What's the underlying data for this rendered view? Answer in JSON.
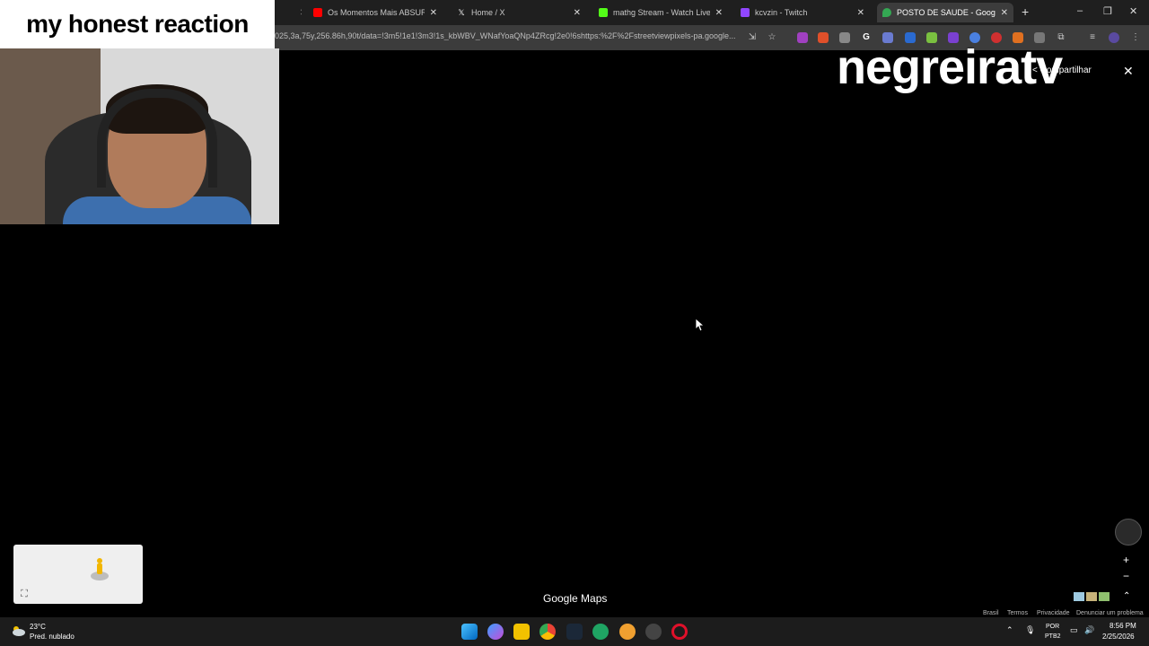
{
  "overlay": {
    "title": "my honest reaction",
    "watermark": "negreiratv"
  },
  "browser": {
    "tabs": [
      {
        "title": "Os Momentos Mais ABSURDOS",
        "color": "#ff0000"
      },
      {
        "title": "Home / X",
        "color": "#ffffff"
      },
      {
        "title": "mathg Stream - Watch Live on",
        "color": "#53fc18"
      },
      {
        "title": "kcvzin - Twitch",
        "color": "#9146ff"
      },
      {
        "title": "POSTO DE SAUDE - Google Ma",
        "color": "#34a853",
        "active": true
      }
    ],
    "url": "025,3a,75y,256.86h,90t/data=!3m5!1e1!3m3!1s_kbWBV_WNafYoaQNp4ZRcg!2e0!6shttps:%2F%2Fstreetviewpixels-pa.google..."
  },
  "maps": {
    "share_label": "Compartilhar",
    "brand": "Google Maps",
    "footer": {
      "country": "Brasil",
      "terms": "Termos",
      "privacy": "Privacidade",
      "report": "Denunciar um problema"
    }
  },
  "taskbar": {
    "weather_temp": "23°C",
    "weather_desc": "Pred. nublado",
    "lang_line1": "POR",
    "lang_line2": "PTB2",
    "time": "8:56 PM",
    "date": "2/25/2026"
  }
}
